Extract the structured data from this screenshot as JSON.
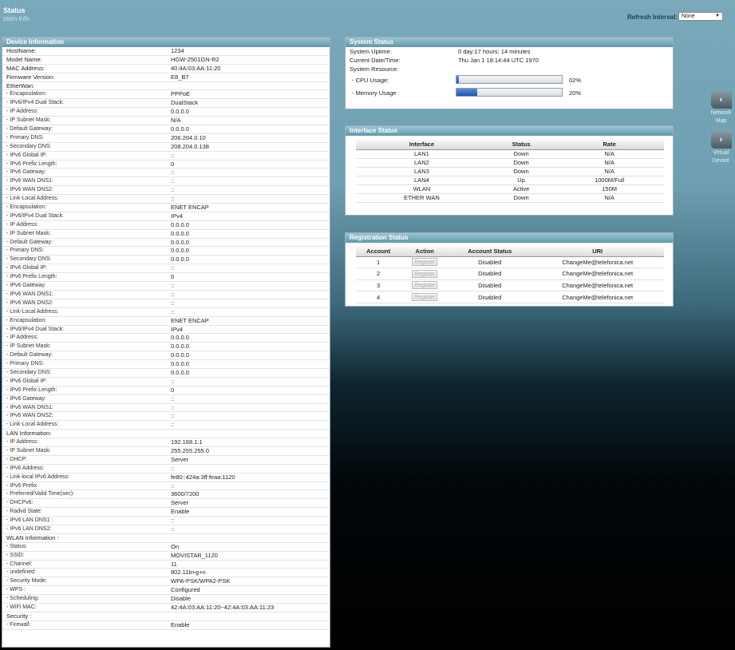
{
  "header": {
    "title": "Status",
    "subtitle": "stem Info",
    "refresh_label": "Refresh Interval:",
    "refresh_value": "None"
  },
  "side_nav": [
    {
      "label_1": "Network",
      "label_2": "Map",
      "icon": "chevron-left-icon"
    },
    {
      "label_1": "Virtual",
      "label_2": "Device",
      "icon": "chevron-right-icon"
    }
  ],
  "device_info": {
    "title": "Device Information",
    "rows": [
      {
        "k": "HostName:",
        "v": "1234"
      },
      {
        "k": "Model Name:",
        "v": "HGW-2501GN-R2"
      },
      {
        "k": "MAC Address:",
        "v": "40:4A:03:AA:11:20"
      },
      {
        "k": "Firmware Version:",
        "v": "E8_B7"
      },
      {
        "k": "EtherWan:",
        "v": ""
      },
      {
        "k": "- Encapsulation:",
        "v": "PPPoE"
      },
      {
        "k": "- IPv6/IPv4 Dual Stack:",
        "v": "DualStack"
      },
      {
        "k": "- IP Address:",
        "v": "0.0.0.0"
      },
      {
        "k": "- IP Subnet Mask:",
        "v": "N/A"
      },
      {
        "k": "- Default Gateway:",
        "v": "0.0.0.0"
      },
      {
        "k": "- Primary DNS:",
        "v": "206.204.0.10"
      },
      {
        "k": "- Secondary DNS:",
        "v": "208.204.0.138"
      },
      {
        "k": "- IPv6 Global IP:",
        "v": "::"
      },
      {
        "k": "- IPv6 Prefix Length:",
        "v": "0"
      },
      {
        "k": "- IPv6 Gateway:",
        "v": "::"
      },
      {
        "k": "- IPv6 WAN DNS1:",
        "v": "::"
      },
      {
        "k": "- IPv6 WAN DNS2:",
        "v": "::"
      },
      {
        "k": "- Link-Local Address:",
        "v": "::"
      },
      {
        "k": "- Encapsulation:",
        "v": "ENET ENCAP"
      },
      {
        "k": "- IPv6/IPv4 Dual Stack:",
        "v": "IPv4"
      },
      {
        "k": "- IP Address:",
        "v": "0.0.0.0"
      },
      {
        "k": "- IP Subnet Mask:",
        "v": "0.0.0.0"
      },
      {
        "k": "- Default Gateway:",
        "v": "0.0.0.0"
      },
      {
        "k": "- Primary DNS:",
        "v": "0.0.0.0"
      },
      {
        "k": "- Secondary DNS:",
        "v": "0.0.0.0"
      },
      {
        "k": "- IPv6 Global IP:",
        "v": "::"
      },
      {
        "k": "- IPv6 Prefix Length:",
        "v": "0"
      },
      {
        "k": "- IPv6 Gateway:",
        "v": "::"
      },
      {
        "k": "- IPv6 WAN DNS1:",
        "v": "::"
      },
      {
        "k": "- IPv6 WAN DNS2:",
        "v": "::"
      },
      {
        "k": "- Link-Local Address:",
        "v": "::"
      },
      {
        "k": "- Encapsulation:",
        "v": "ENET ENCAP"
      },
      {
        "k": "- IPv6/IPv4 Dual Stack:",
        "v": "IPv4"
      },
      {
        "k": "- IP Address:",
        "v": "0.0.0.0"
      },
      {
        "k": "- IP Subnet Mask:",
        "v": "0.0.0.0"
      },
      {
        "k": "- Default Gateway:",
        "v": "0.0.0.0"
      },
      {
        "k": "- Primary DNS:",
        "v": "0.0.0.0"
      },
      {
        "k": "- Secondary DNS:",
        "v": "0.0.0.0"
      },
      {
        "k": "- IPv6 Global IP:",
        "v": "::"
      },
      {
        "k": "- IPv6 Prefix Length:",
        "v": "0"
      },
      {
        "k": "- IPv6 Gateway:",
        "v": "::"
      },
      {
        "k": "- IPv6 WAN DNS1:",
        "v": "::"
      },
      {
        "k": "- IPv6 WAN DNS2:",
        "v": "::"
      },
      {
        "k": "- Link-Local Address:",
        "v": "::"
      },
      {
        "k": "LAN Information:",
        "v": ""
      },
      {
        "k": "- IP Address:",
        "v": "192.168.1.1"
      },
      {
        "k": "- IP Subnet Mask:",
        "v": "255.255.255.0"
      },
      {
        "k": "- DHCP:",
        "v": "Server"
      },
      {
        "k": "- IPv6 Address:",
        "v": "::"
      },
      {
        "k": "- Link-local IPv6 Address:",
        "v": "fe80::424a:3ff:feaa:1120"
      },
      {
        "k": "- IPv6 Prefix",
        "v": "::"
      },
      {
        "k": "- Preferred/Valid Time(sec):",
        "v": "3600/7200"
      },
      {
        "k": "- DHCPv6:",
        "v": "Server"
      },
      {
        "k": "- Radvd State:",
        "v": "Enable"
      },
      {
        "k": "- IPv6 LAN DNS1 :",
        "v": "::"
      },
      {
        "k": "- IPv6 LAN DNS2:",
        "v": "::"
      },
      {
        "k": "WLAN Information :",
        "v": ""
      },
      {
        "k": "- Status:",
        "v": "On"
      },
      {
        "k": "- SSID:",
        "v": "MOVISTAR_1120"
      },
      {
        "k": "- Channel:",
        "v": "11"
      },
      {
        "k": "- undefined:",
        "v": "802.11b+g+n"
      },
      {
        "k": "- Security Mode:",
        "v": "WPA-PSK/WPA2-PSK"
      },
      {
        "k": "- WPS :",
        "v": "Configured"
      },
      {
        "k": "- Scheduling:",
        "v": "Disable"
      },
      {
        "k": "- WiFi MAC:",
        "v": "42:4A:03:AA:11:20~42:4A:03:AA:11:23"
      },
      {
        "k": "Security :",
        "v": ""
      },
      {
        "k": "- Firewall:",
        "v": "Enable"
      }
    ]
  },
  "system_status": {
    "title": "System Status",
    "uptime_label": "System Uptime:",
    "uptime_value": "0 day:17 hours: 14 minutes",
    "datetime_label": "Current Date/Time:",
    "datetime_value": "Thu Jan 1 18:14:44 UTC 1970",
    "resource_label": "System Resource:",
    "cpu_label": "- CPU Usage:",
    "cpu_value": "02%",
    "cpu_fraction": 0.02,
    "mem_label": "- Memory Usage",
    "mem_value": "20%",
    "mem_fraction": 0.2
  },
  "interface_status": {
    "title": "Interface Status",
    "headers": [
      "Interface",
      "Status",
      "Rate"
    ],
    "rows": [
      [
        "LAN1",
        "Down",
        "N/A"
      ],
      [
        "LAN2",
        "Down",
        "N/A"
      ],
      [
        "LAN3",
        "Down",
        "N/A"
      ],
      [
        "LAN4",
        "Up",
        "1000M/Full"
      ],
      [
        "WLAN",
        "Active",
        "150M"
      ],
      [
        "ETHER WAN",
        "Down",
        "N/A"
      ]
    ]
  },
  "registration_status": {
    "title": "Registration Status",
    "headers": [
      "Account",
      "Action",
      "Account Status",
      "URI"
    ],
    "button_label": "Register",
    "rows": [
      [
        "1",
        "Disabled",
        "ChangeMe@telefonica.net"
      ],
      [
        "2",
        "Disabled",
        "ChangeMe@telefonica.net"
      ],
      [
        "3",
        "Disabled",
        "ChangeMe@telefonica.net"
      ],
      [
        "4",
        "Disabled",
        "ChangeMe@telefonica.net"
      ]
    ]
  }
}
